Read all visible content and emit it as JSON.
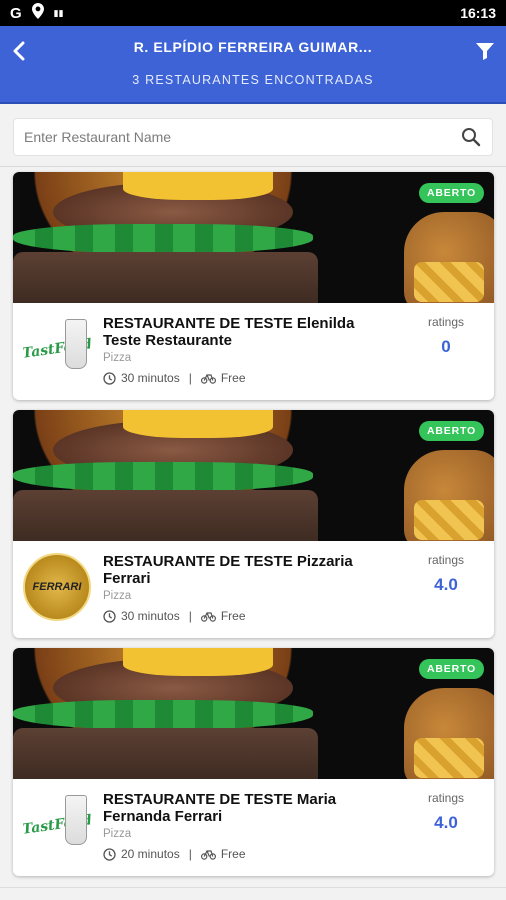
{
  "status_bar": {
    "time": "16:13",
    "left_icons": [
      "google-g-icon",
      "location-pin-icon",
      "notification-icon"
    ]
  },
  "header": {
    "title": "R. ELPÍDIO FERREIRA GUIMAR...",
    "subtitle": "3 RESTAURANTES ENCONTRADAS",
    "back_icon": "chevron-left-icon",
    "filter_icon": "filter-icon",
    "color": "#3d63d6"
  },
  "search": {
    "placeholder": "Enter Restaurant Name",
    "value": "",
    "icon": "search-icon"
  },
  "restaurants": [
    {
      "badge": "ABERTO",
      "name": "RESTAURANTE DE TESTE Elenilda Teste Restaurante",
      "category": "Pizza",
      "time": "30 minutos",
      "delivery": "Free",
      "ratings_label": "ratings",
      "rating": "0",
      "logo": "TastFood"
    },
    {
      "badge": "ABERTO",
      "name": "RESTAURANTE DE TESTE Pizzaria Ferrari",
      "category": "Pizza",
      "time": "30 minutos",
      "delivery": "Free",
      "ratings_label": "ratings",
      "rating": "4.0",
      "logo": "FERRARI"
    },
    {
      "badge": "ABERTO",
      "name": "RESTAURANTE DE TESTE Maria Fernanda Ferrari",
      "category": "Pizza",
      "time": "20 minutos",
      "delivery": "Free",
      "ratings_label": "ratings",
      "rating": "4.0",
      "logo": "TastFood"
    }
  ],
  "colors": {
    "accent": "#3d63d6",
    "open_badge": "#34c45a"
  }
}
